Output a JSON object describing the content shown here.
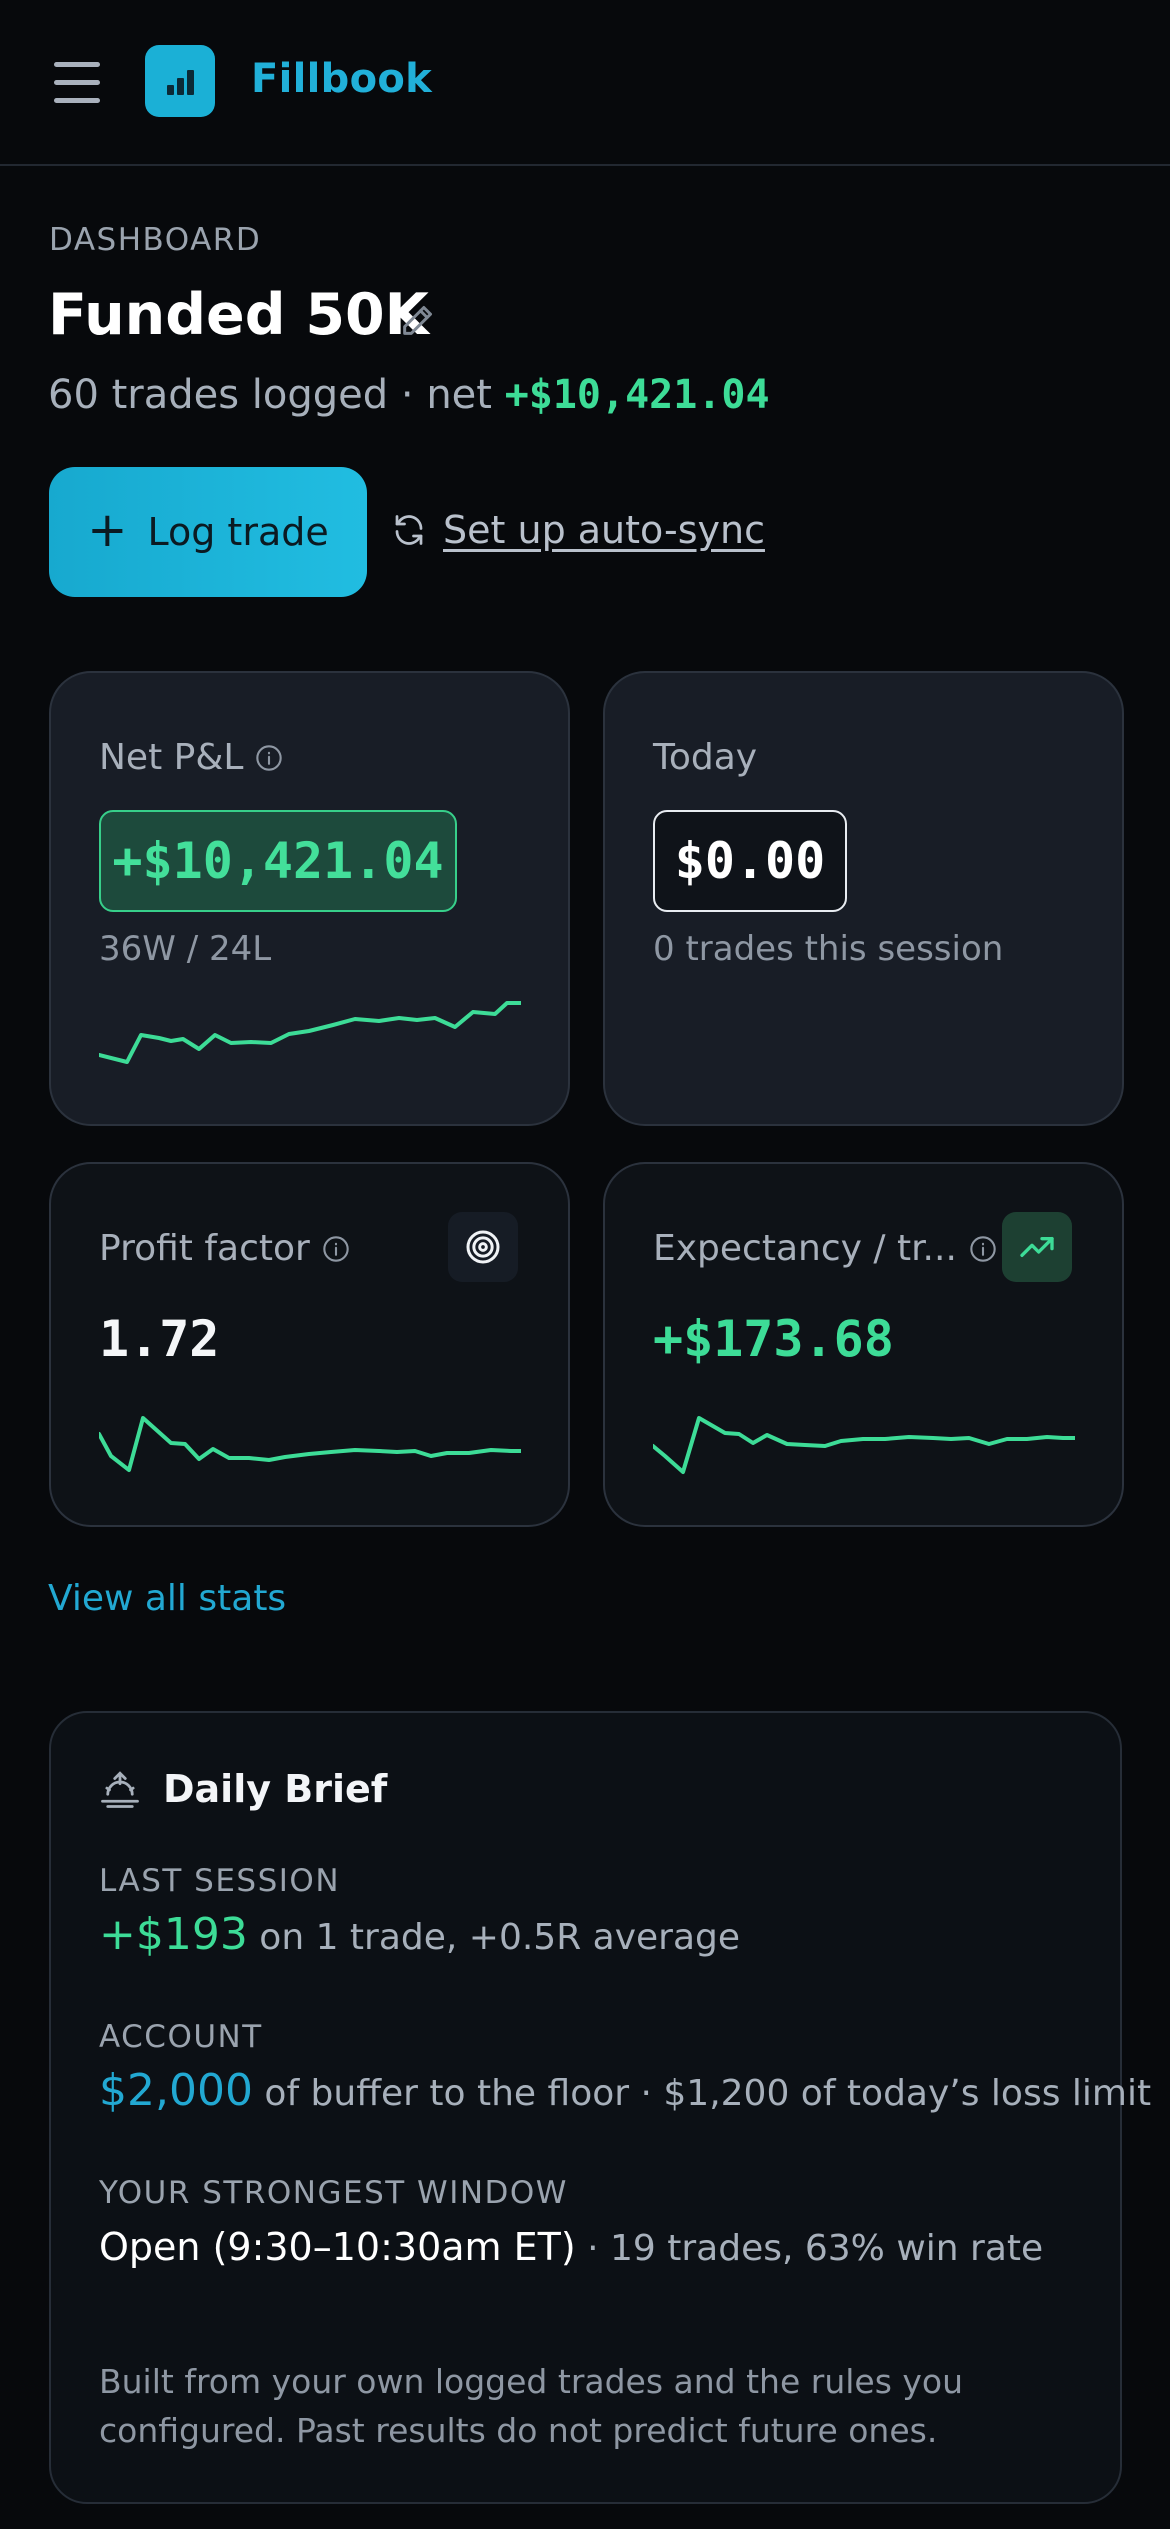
{
  "app": {
    "name": "Fillbook"
  },
  "header": {
    "eyebrow": "DASHBOARD",
    "title": "Funded 50K"
  },
  "summary": {
    "prefix": "60 trades logged · net ",
    "net": "+$10,421.04"
  },
  "actions": {
    "log_trade": "Log trade",
    "auto_sync": "Set up auto-sync"
  },
  "cards": {
    "net_pnl": {
      "label": "Net P&L",
      "value": "+$10,421.04",
      "record": "36W / 24L"
    },
    "today": {
      "label": "Today",
      "value": "$0.00",
      "sub": "0 trades this session"
    },
    "profit_factor": {
      "label": "Profit factor",
      "value": "1.72"
    },
    "expectancy": {
      "label": "Expectancy / tr...",
      "value": "+$173.68"
    }
  },
  "view_all": "View all stats",
  "brief": {
    "title": "Daily Brief",
    "last_session": {
      "label": "LAST SESSION",
      "amount": "+$193",
      "rest": " on 1 trade, +0.5R average"
    },
    "account": {
      "label": "ACCOUNT",
      "amount": "$2,000",
      "rest": " of buffer to the floor · $1,200 of today’s loss limit"
    },
    "window": {
      "label": "YOUR STRONGEST WINDOW",
      "name": "Open (9:30–10:30am ET)",
      "rest": " · 19 trades, 63% win rate"
    },
    "disclaimer": "Built from your own logged trades and the rules you configured. Past results do not predict future ones."
  },
  "colors": {
    "accent": "#21b0d9",
    "positive": "#3ddc97",
    "background": "#07090c",
    "card": "#181d26"
  },
  "icons": [
    "menu-icon",
    "bar-chart-logo",
    "pencil-icon",
    "plus-icon",
    "refresh-icon",
    "info-icon",
    "target-icon",
    "trending-up-icon",
    "sunrise-icon"
  ]
}
